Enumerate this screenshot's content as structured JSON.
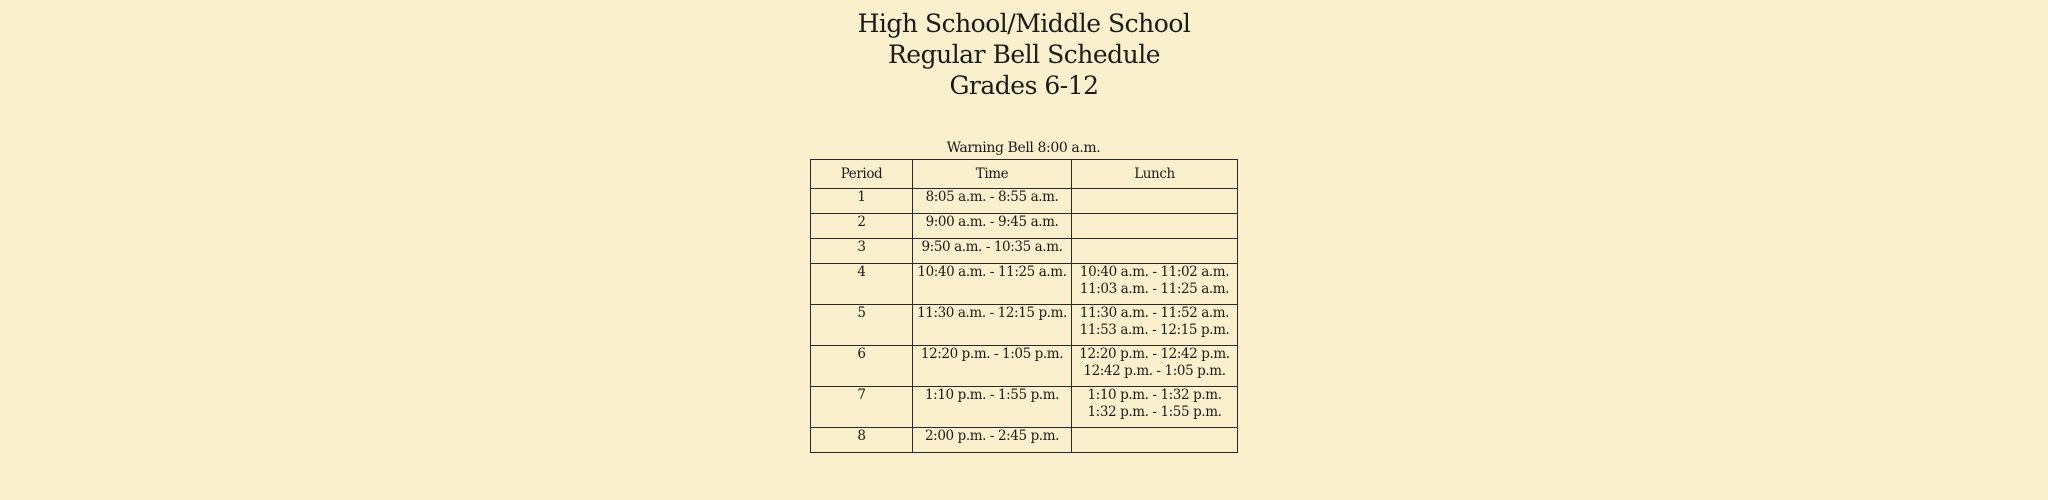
{
  "header": {
    "line1": "High School/Middle School",
    "line2": "Regular Bell Schedule",
    "line3": "Grades 6-12"
  },
  "warning_bell": "Warning Bell 8:00 a.m.",
  "table": {
    "columns": [
      "Period",
      "Time",
      "Lunch"
    ],
    "rows": [
      {
        "period": "1",
        "time": "8:05 a.m. - 8:55 a.m.",
        "lunch": [
          "",
          ""
        ]
      },
      {
        "period": "2",
        "time": "9:00 a.m.  - 9:45 a.m.",
        "lunch": [
          "",
          ""
        ]
      },
      {
        "period": "3",
        "time": "9:50 a.m.  - 10:35 a.m.",
        "lunch": [
          "",
          ""
        ]
      },
      {
        "period": "4",
        "time": "10:40 a.m.  - 11:25 a.m.",
        "lunch": [
          "10:40 a.m.  - 11:02 a.m.",
          "11:03 a.m.  - 11:25 a.m."
        ]
      },
      {
        "period": "5",
        "time": "11:30 a.m.  - 12:15 p.m.",
        "lunch": [
          "11:30 a.m.  - 11:52 a.m.",
          "11:53 a.m.  - 12:15 p.m."
        ]
      },
      {
        "period": "6",
        "time": "12:20 p.m.  - 1:05 p.m.",
        "lunch": [
          "12:20 p.m.  - 12:42 p.m.",
          "12:42 p.m.  - 1:05 p.m."
        ]
      },
      {
        "period": "7",
        "time": "1:10 p.m.  - 1:55 p.m.",
        "lunch": [
          "1:10 p.m.  - 1:32 p.m.",
          "1:32 p.m.  - 1:55 p.m."
        ]
      },
      {
        "period": "8",
        "time": "2:00 p.m.  - 2:45 p.m.",
        "lunch": [
          "",
          ""
        ]
      }
    ]
  }
}
